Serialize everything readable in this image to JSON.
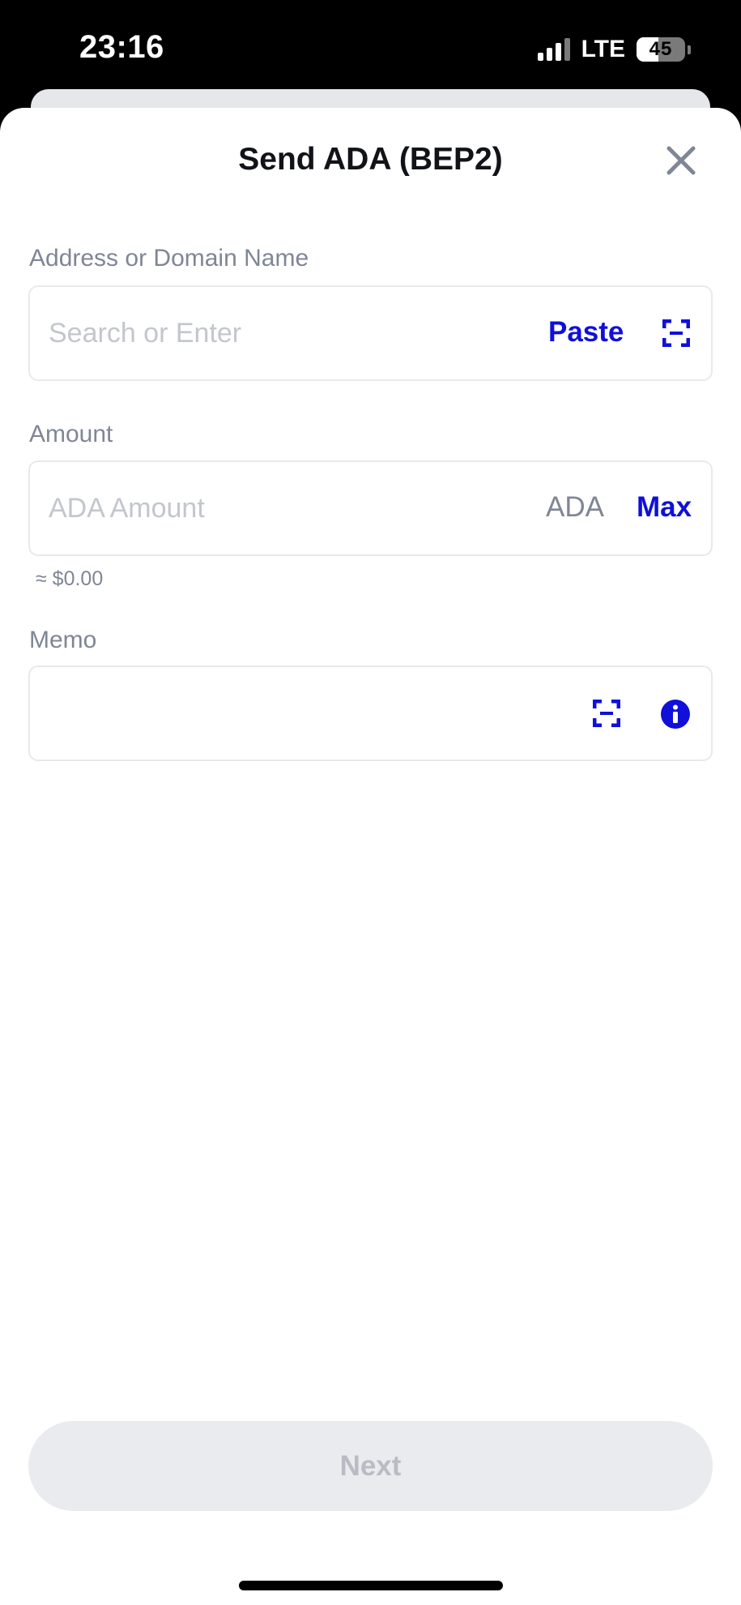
{
  "status_bar": {
    "time": "23:16",
    "network": "LTE",
    "battery_level": "45"
  },
  "sheet": {
    "title": "Send ADA (BEP2)"
  },
  "address_field": {
    "label": "Address or Domain Name",
    "placeholder": "Search or Enter",
    "paste_label": "Paste",
    "scan_icon": "qr-scan-icon"
  },
  "amount_field": {
    "label": "Amount",
    "placeholder": "ADA Amount",
    "unit": "ADA",
    "max_label": "Max",
    "fiat_value": "≈ $0.00"
  },
  "memo_field": {
    "label": "Memo",
    "scan_icon": "qr-scan-icon",
    "info_icon": "info-icon"
  },
  "footer": {
    "next_label": "Next"
  },
  "colors": {
    "accent": "#1010d8",
    "label": "#7f8695",
    "placeholder": "#c3c6cd",
    "disabled_button_bg": "#eaebee",
    "disabled_button_text": "#b9bcc4"
  }
}
